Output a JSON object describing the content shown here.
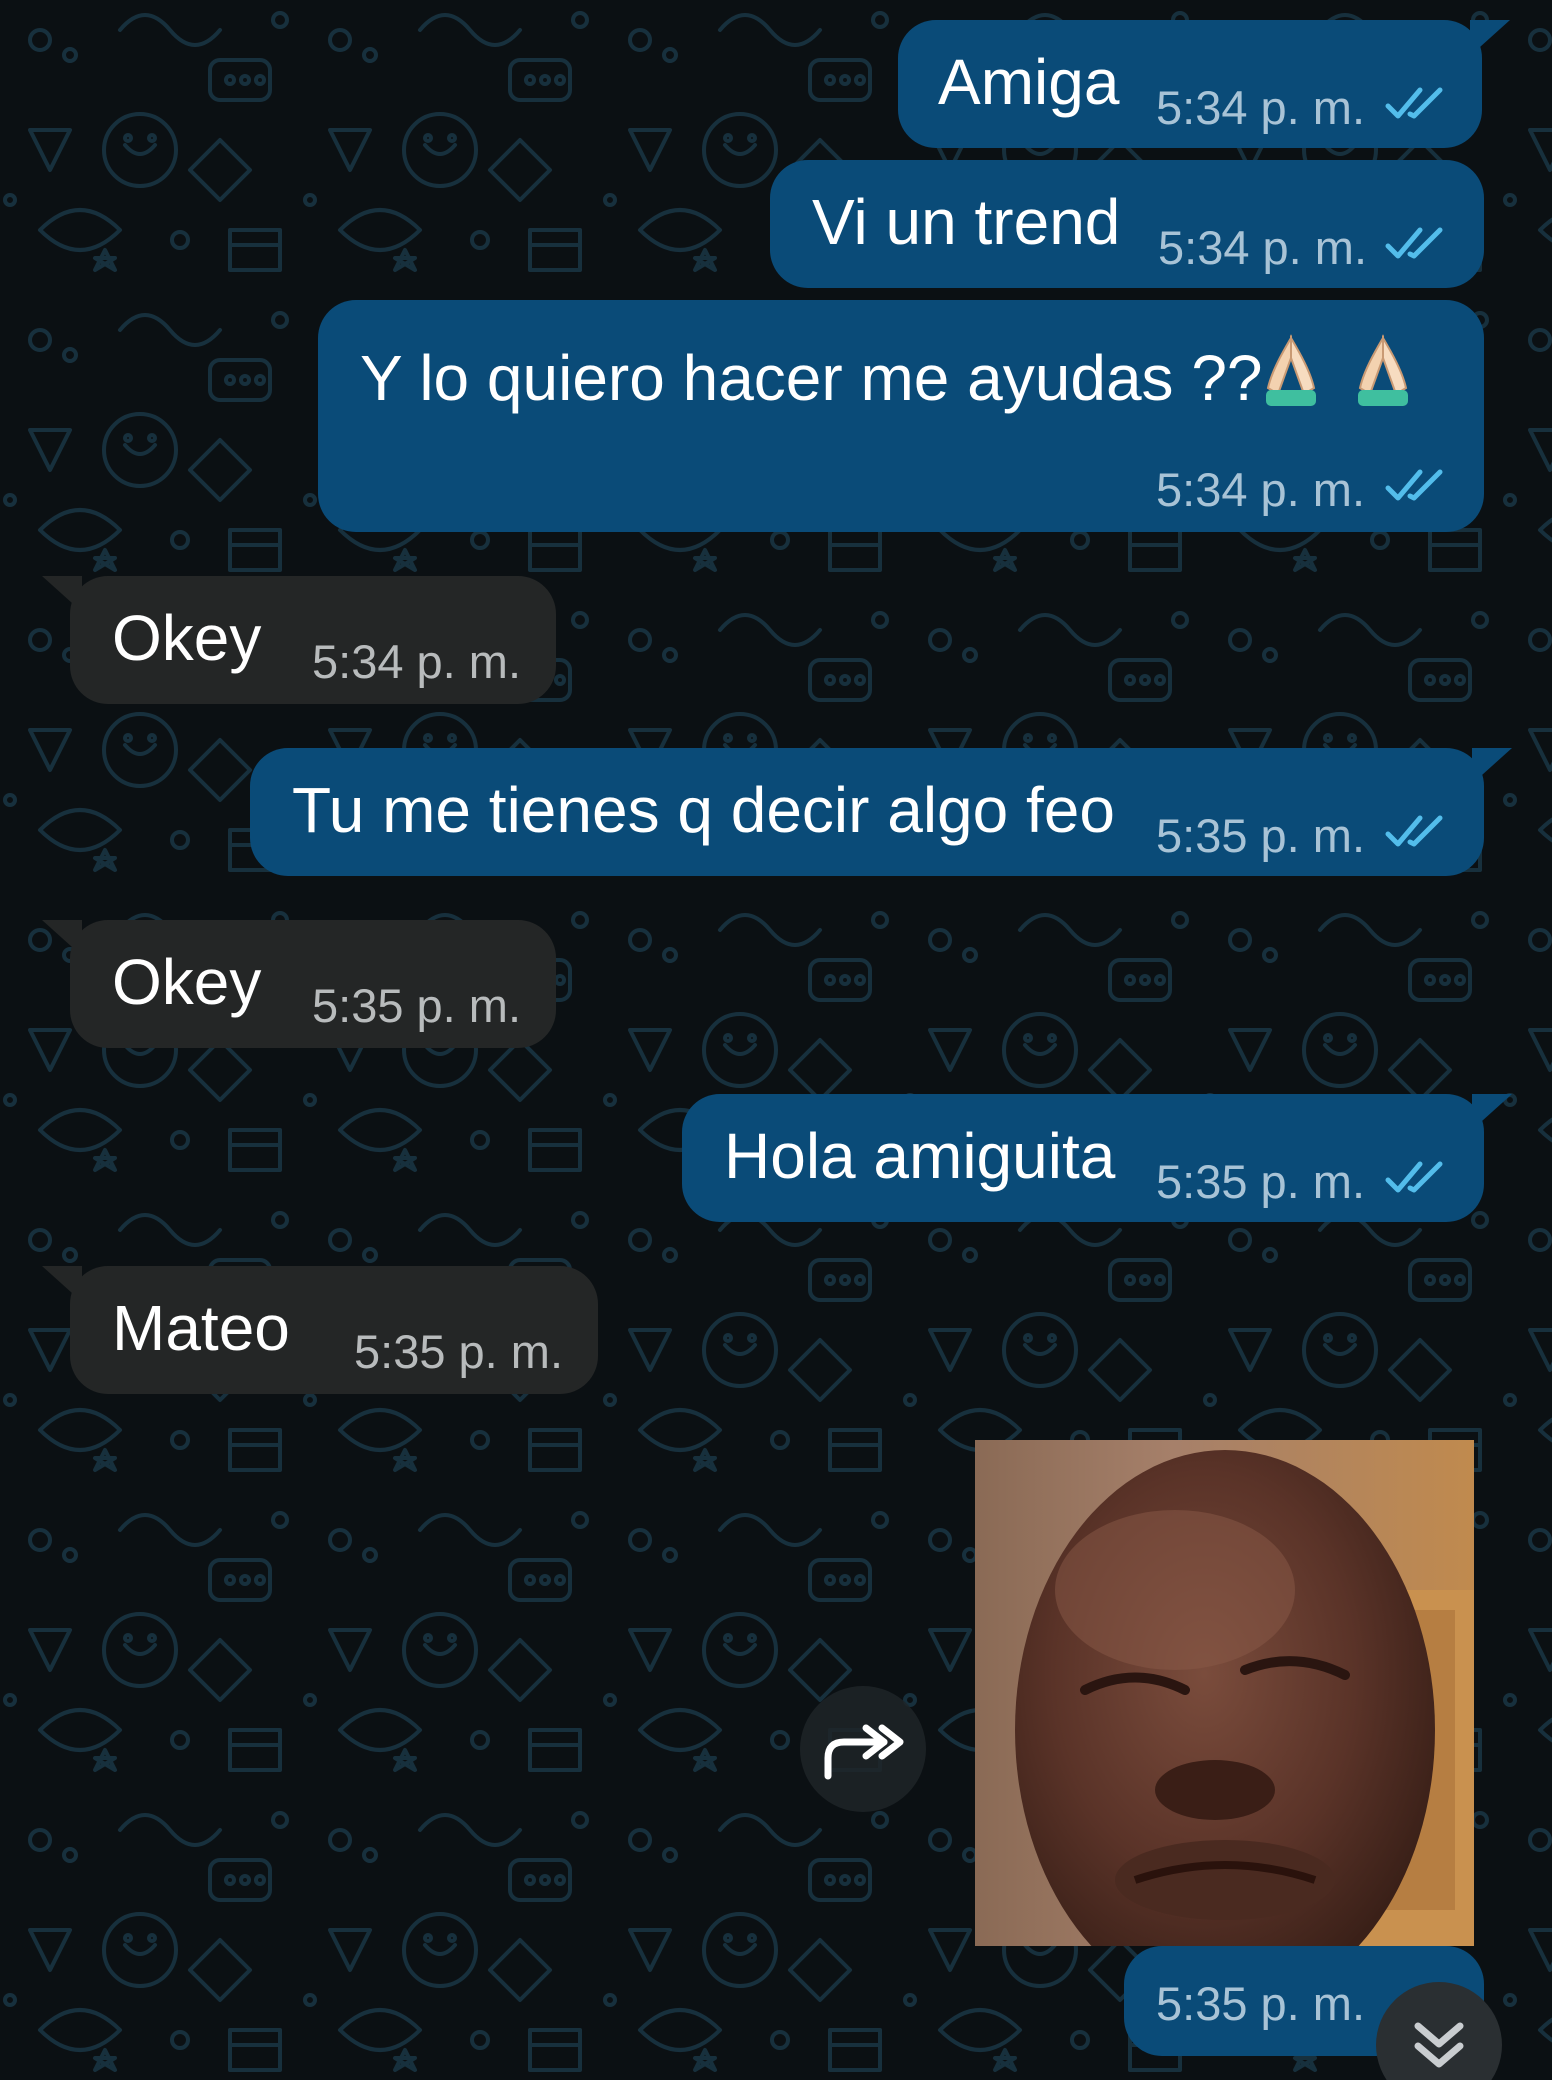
{
  "messages": [
    {
      "id": "m1",
      "direction": "outgoing",
      "text": "Amiga",
      "time": "5:34 p. m.",
      "status": "read"
    },
    {
      "id": "m2",
      "direction": "outgoing",
      "text": "Vi un trend",
      "time": "5:34 p. m.",
      "status": "read"
    },
    {
      "id": "m3",
      "direction": "outgoing",
      "text": "Y lo quiero hacer me ayudas ??",
      "emoji": "🙏🏻🙏🏻",
      "time": "5:34 p. m.",
      "status": "read"
    },
    {
      "id": "m4",
      "direction": "incoming",
      "text": "Okey",
      "time": "5:34 p. m."
    },
    {
      "id": "m5",
      "direction": "outgoing",
      "text": "Tu me tienes q decir algo feo",
      "time": "5:35 p. m.",
      "status": "read"
    },
    {
      "id": "m6",
      "direction": "incoming",
      "text": "Okey",
      "time": "5:35 p. m."
    },
    {
      "id": "m7",
      "direction": "outgoing",
      "text": "Hola amiguita",
      "time": "5:35 p. m.",
      "status": "read"
    },
    {
      "id": "m8",
      "direction": "incoming",
      "text": "Mateo",
      "time": "5:35 p. m."
    },
    {
      "id": "m9",
      "direction": "outgoing",
      "type": "photo",
      "time": "5:35 p. m."
    }
  ],
  "icons": {
    "read_ticks": "double-check-icon",
    "forward": "forward-icon",
    "scroll_down": "double-chevron-down-icon"
  },
  "colors": {
    "background": "#0b1013",
    "outgoing_bubble": "#0a4b78",
    "incoming_bubble": "#242626",
    "read_ticks": "#53bdeb",
    "time_outgoing": "#a8c3d6",
    "time_incoming": "#b8bbbc"
  }
}
